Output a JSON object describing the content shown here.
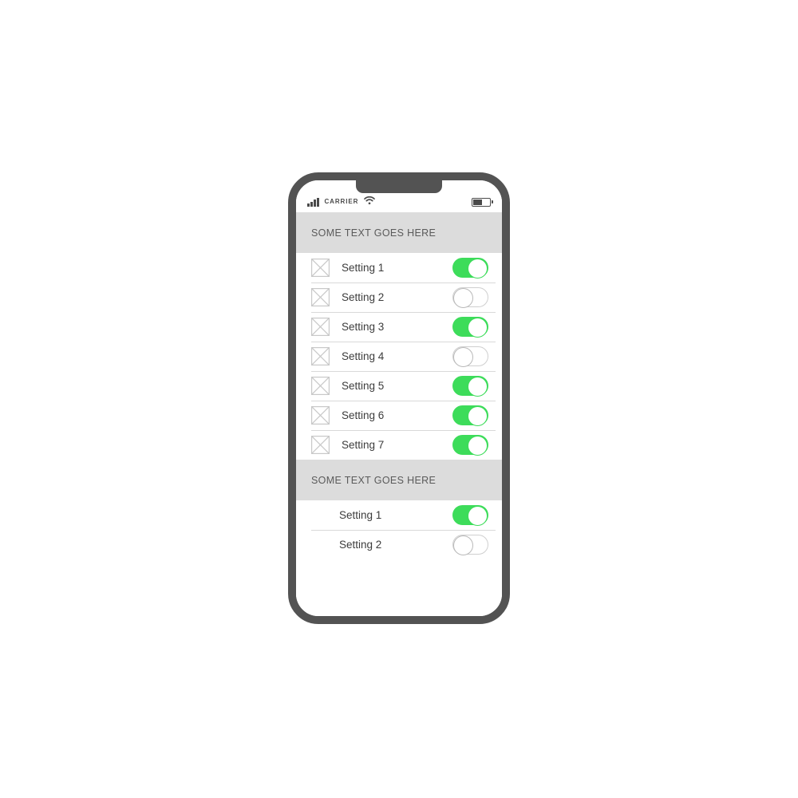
{
  "device": {
    "name": "smartphone-mockup",
    "frame_color": "#535353",
    "screen_background": "#ffffff"
  },
  "status_bar": {
    "signal_icon": "signal-bars-icon",
    "signal_bars": 4,
    "carrier": "CARRIER",
    "wifi_icon": "wifi-icon",
    "battery_icon": "battery-icon",
    "battery_level_percent": 52
  },
  "theme": {
    "toggle_on_color": "#3ddc5a",
    "toggle_off_border": "#cfcfcf",
    "section_header_bg": "#dcdcdc",
    "section_header_text": "#5a5a5a",
    "divider_color": "#d9d9d9",
    "label_color": "#3c3c3c"
  },
  "sections": [
    {
      "header": "SOME TEXT GOES HERE",
      "has_icons": true,
      "rows": [
        {
          "icon": "image-placeholder-icon",
          "label": "Setting 1",
          "toggle": "on"
        },
        {
          "icon": "image-placeholder-icon",
          "label": "Setting 2",
          "toggle": "off"
        },
        {
          "icon": "image-placeholder-icon",
          "label": "Setting 3",
          "toggle": "on"
        },
        {
          "icon": "image-placeholder-icon",
          "label": "Setting 4",
          "toggle": "off"
        },
        {
          "icon": "image-placeholder-icon",
          "label": "Setting 5",
          "toggle": "on"
        },
        {
          "icon": "image-placeholder-icon",
          "label": "Setting 6",
          "toggle": "on"
        },
        {
          "icon": "image-placeholder-icon",
          "label": "Setting 7",
          "toggle": "on"
        }
      ]
    },
    {
      "header": "SOME TEXT GOES HERE",
      "has_icons": false,
      "rows": [
        {
          "icon": null,
          "label": "Setting 1",
          "toggle": "on"
        },
        {
          "icon": null,
          "label": "Setting 2",
          "toggle": "off"
        }
      ]
    }
  ]
}
